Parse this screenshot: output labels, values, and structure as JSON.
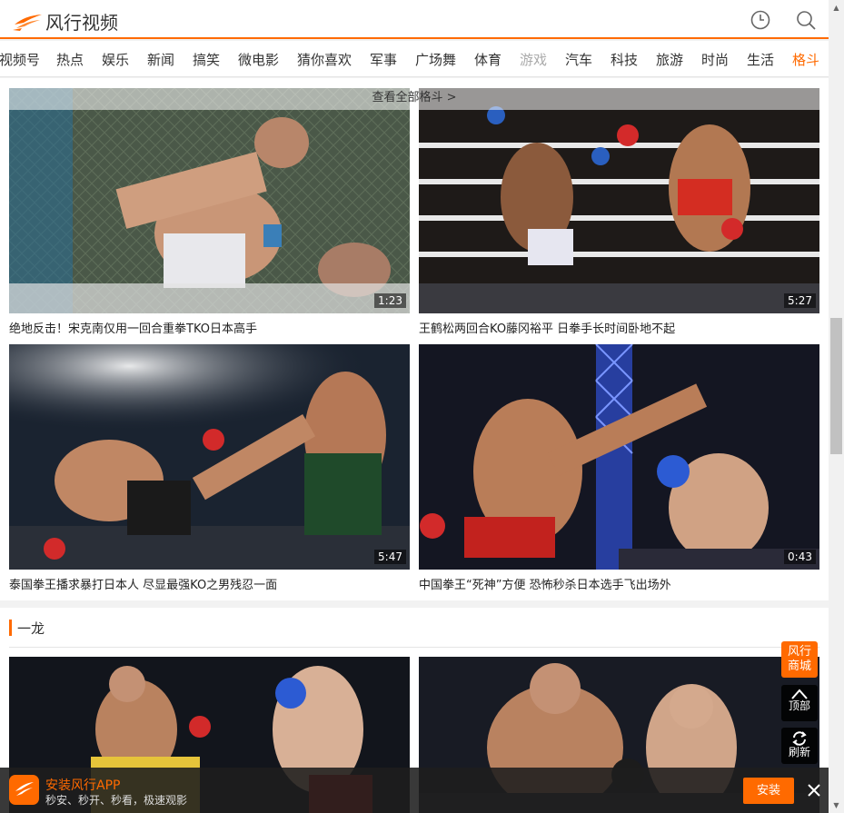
{
  "header": {
    "logo_text": "风行视频"
  },
  "nav": {
    "items": [
      {
        "label": "视频号"
      },
      {
        "label": "热点"
      },
      {
        "label": "娱乐"
      },
      {
        "label": "新闻"
      },
      {
        "label": "搞笑"
      },
      {
        "label": "微电影"
      },
      {
        "label": "猜你喜欢"
      },
      {
        "label": "军事"
      },
      {
        "label": "广场舞"
      },
      {
        "label": "体育"
      },
      {
        "label": "游戏"
      },
      {
        "label": "汽车"
      },
      {
        "label": "科技"
      },
      {
        "label": "旅游"
      },
      {
        "label": "时尚"
      },
      {
        "label": "生活"
      },
      {
        "label": "格斗"
      }
    ],
    "active": "格斗"
  },
  "section1": {
    "view_all": "查看全部格斗 >",
    "videos": [
      {
        "title": "绝地反击！宋克南仅用一回合重拳TKO日本高手",
        "duration": "1:23"
      },
      {
        "title": "王鹤松两回合KO藤冈裕平 日拳手长时间卧地不起",
        "duration": "5:27"
      },
      {
        "title": "泰国拳王播求暴打日本人 尽显最强KO之男残忍一面",
        "duration": "5:47"
      },
      {
        "title": "中国拳王“死神”方便 恐怖秒杀日本选手飞出场外",
        "duration": "0:43"
      }
    ]
  },
  "section2": {
    "title": "一龙"
  },
  "floating": {
    "mall_label": "风行商城",
    "top_label": "顶部",
    "refresh_label": "刷新"
  },
  "app_banner": {
    "title": "安装风行APP",
    "subtitle": "秒安、秒开、秒看，极速观影",
    "install_label": "安装"
  },
  "colors": {
    "accent": "#ff6a00"
  }
}
